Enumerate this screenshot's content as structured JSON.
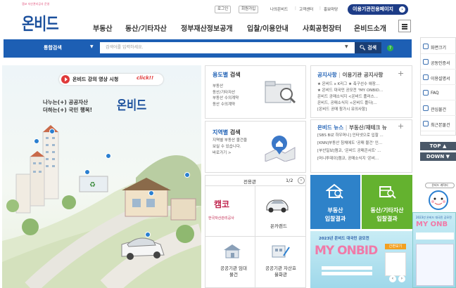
{
  "header": {
    "logo_sub": "캠코 자산관리공사 운영",
    "logo_text": "온비드",
    "util_buttons": [
      "로그인",
      "회원가입"
    ],
    "util_links": [
      "나의온비드",
      "고객센터",
      "홍보마당"
    ],
    "inst_button": "이용기관전용페이지",
    "gnb": [
      "부동산",
      "동산/기타자산",
      "정부재산정보공개",
      "입찰/이용안내",
      "사회공헌장터",
      "온비드소개"
    ]
  },
  "search": {
    "label": "통합검색",
    "placeholder": "검색어를 입력하세요.",
    "button": "검색",
    "help": "?"
  },
  "hero": {
    "video_title": "온비드 강의 영상 시청",
    "video_click": "click!!",
    "slogan1": "나누는(+) 공공자산",
    "slogan2": "더하는(+) 국민 행복!",
    "slogan_logo": "온비드"
  },
  "usage": {
    "title_a": "용도별",
    "title_b": "검색",
    "items": [
      "부동산",
      "동산/기타자산",
      "부동산 수의계약",
      "동산 수의계약"
    ]
  },
  "region": {
    "title_a": "지역별",
    "title_b": "검색",
    "desc": [
      "지역별 부동산 물건을",
      "보실 수 있습니다.",
      "바로가기 >"
    ]
  },
  "notice": {
    "tab1": "공지사항",
    "tab2": "이용기관 공지사항",
    "items": [
      "★ 온비드 x K리그 ★ 축구선수 애장...",
      "★ 온비드 대국민 공모전 \"MY ONBID...",
      "온비드 공매소식지 <온비드 플러스...",
      "온비드, 공매소식지 <온비드 플다(...",
      "[온비드 공매 참가시 유의사항]"
    ]
  },
  "news": {
    "tab1": "온비드 뉴스",
    "tab2": "부동산/재테크 뉴",
    "items": [
      "[SBS BIZ 하우머니] 인터넷으로 입찰 ...",
      "[KNN]부동산 침체에도 '공매 물건' 인...",
      "[부산일보]캠코, '온비드 공매콘서트' ...",
      "[머니투데이]캠코, 공매소식지 '온비..."
    ]
  },
  "exclusive": {
    "title": "전용관",
    "page": "1/2",
    "items": [
      "한국자산관리공사",
      "온카랜드",
      "공공기관 임대물건",
      "공공기관 자산효율화관"
    ],
    "kamco_logo": "캠코"
  },
  "tiles": {
    "re_result": [
      "부동산",
      "입찰결과"
    ],
    "mv_result": [
      "동산/기타자산",
      "입찰결과"
    ]
  },
  "banner": {
    "title": "2023년 온비드 대국민 공모전",
    "big": "MY ONBID",
    "tag": "간편보기"
  },
  "sidebar": {
    "items": [
      "화면크기",
      "공동인증서",
      "이용설명서",
      "FAQ",
      "관심물건",
      "최근본물건"
    ],
    "top": "TOP",
    "down": "DOWN",
    "bubble": "온비드 캐릭터"
  },
  "mini_banner": {
    "line1": "2023년 온비드 대국민 공모전",
    "line2": "MY ONB"
  }
}
